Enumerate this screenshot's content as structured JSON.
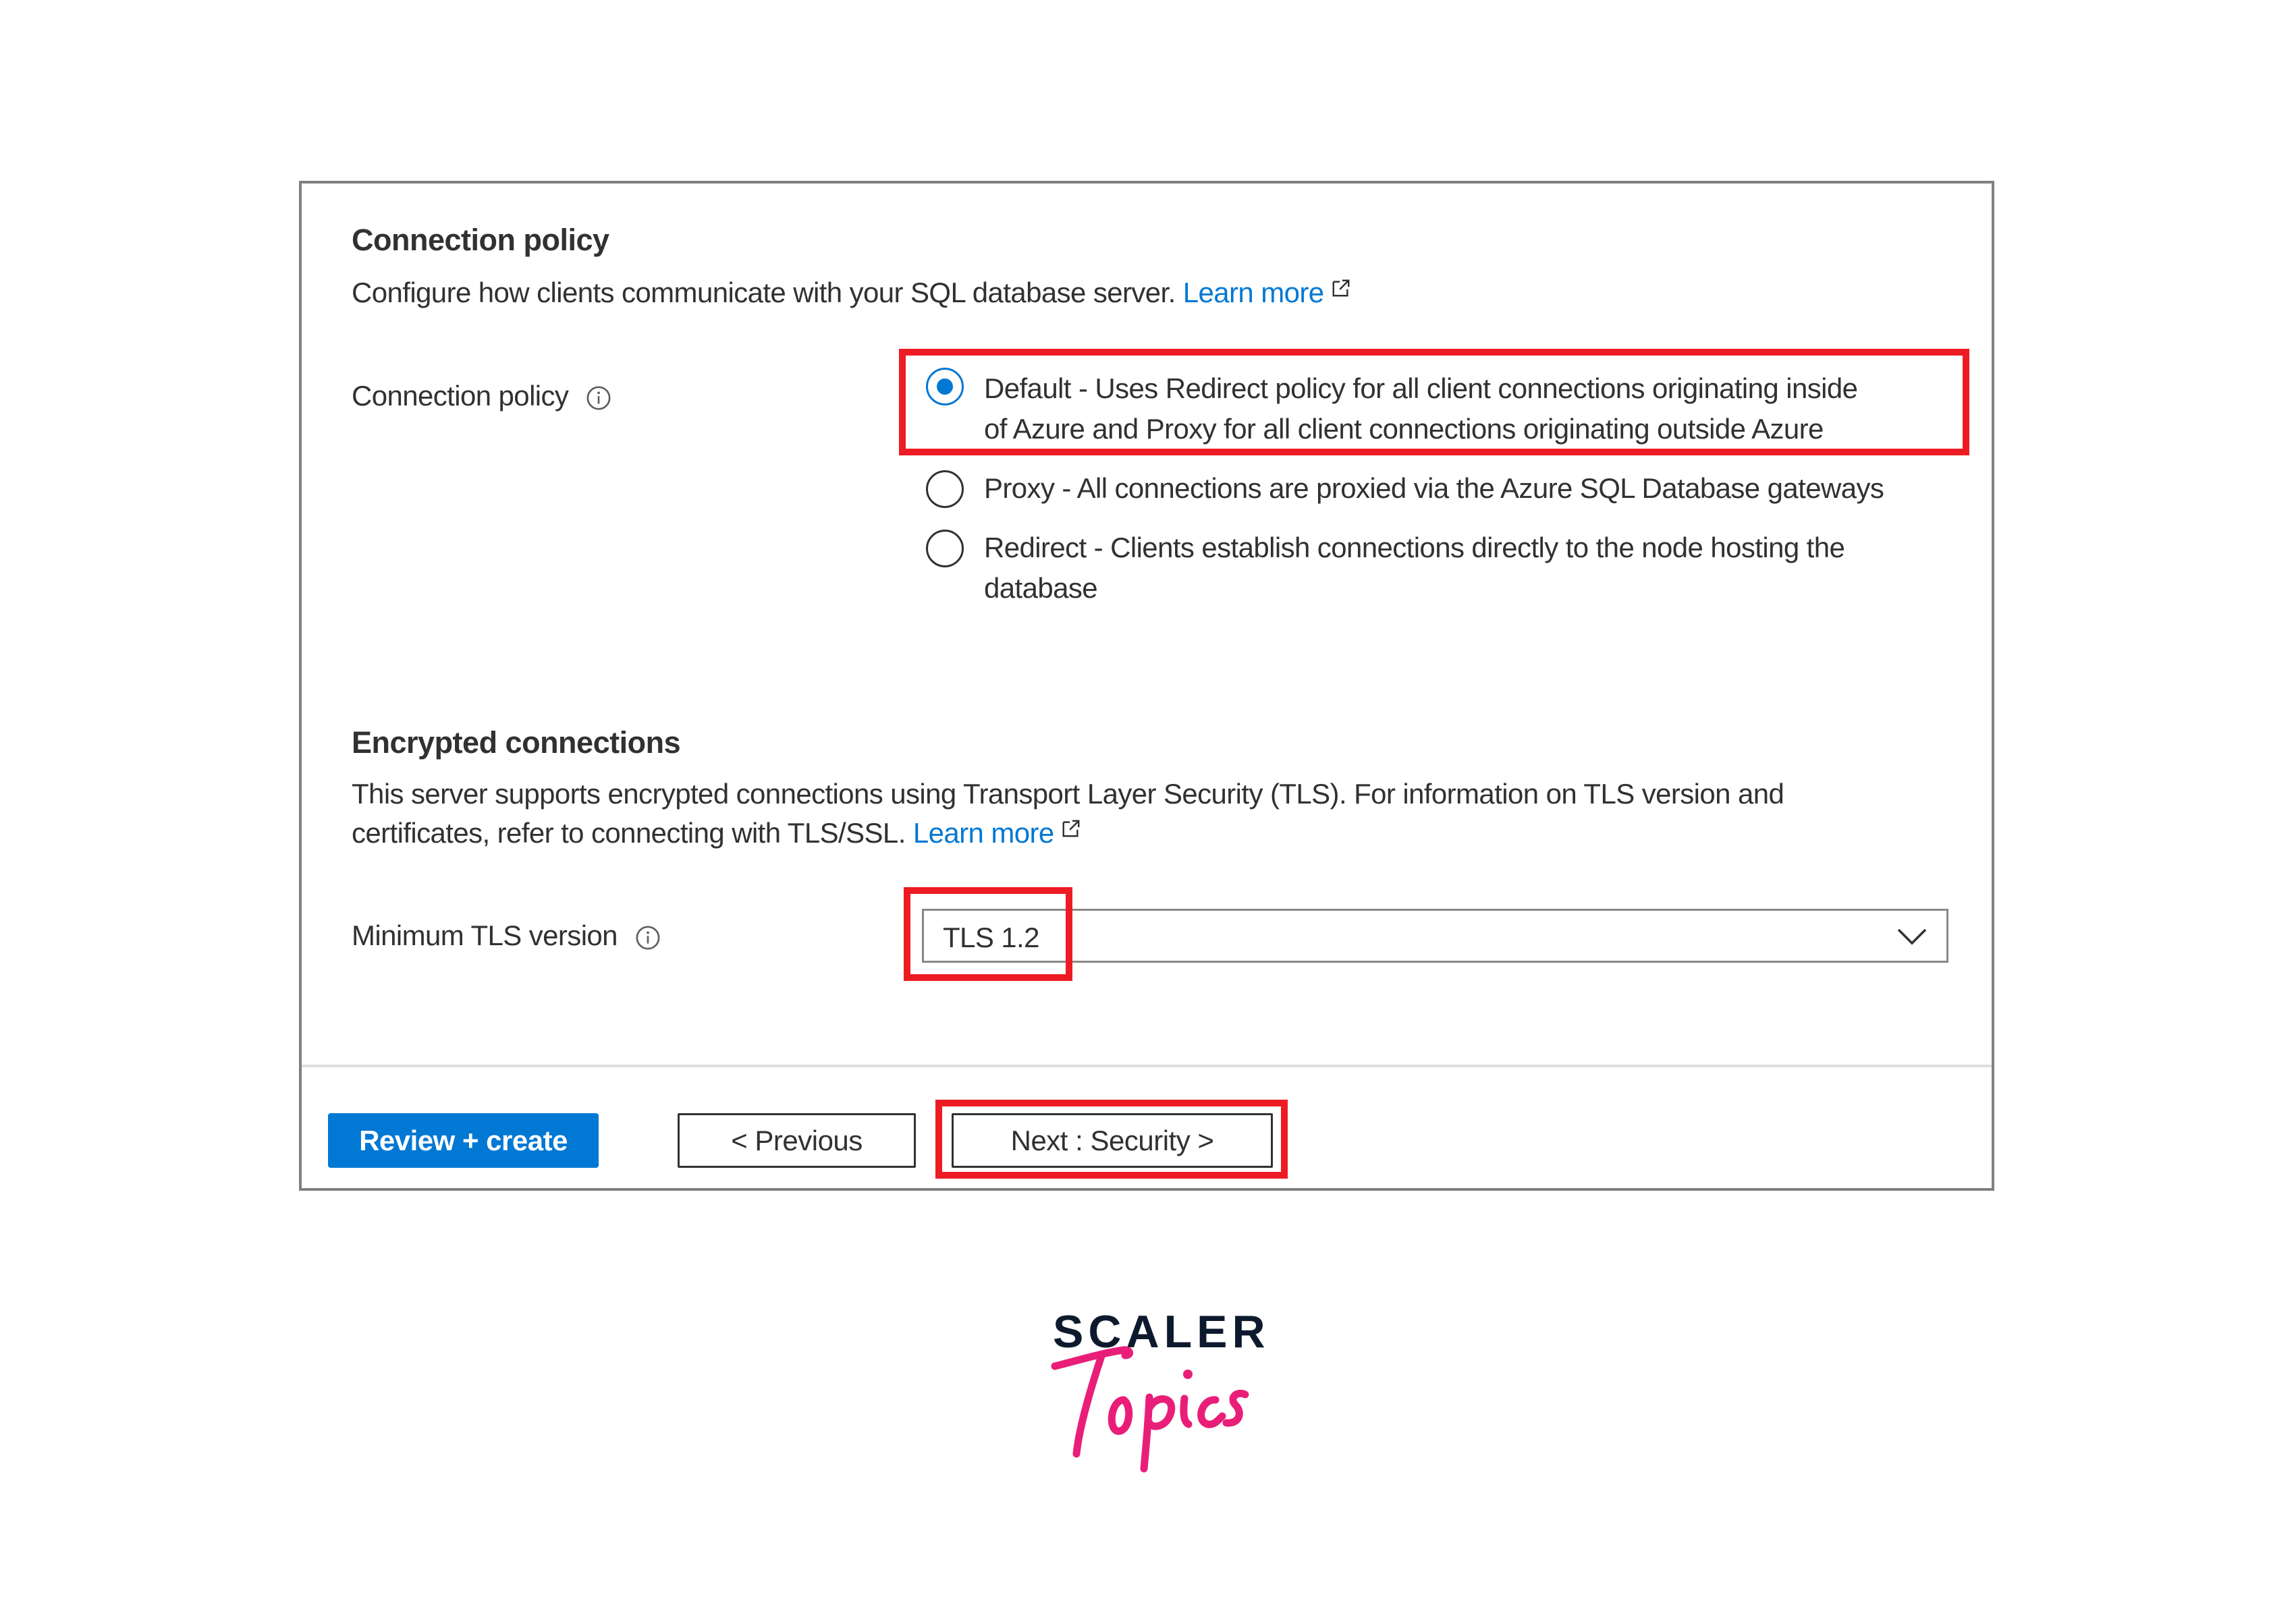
{
  "connection_policy_section": {
    "title": "Connection policy",
    "description": "Configure how clients communicate with your SQL database server.",
    "learn_more": "Learn more",
    "field_label": "Connection policy",
    "options": [
      {
        "label": "Default - Uses Redirect policy for all client connections originating inside",
        "label_line2": "of Azure and Proxy for all client connections originating outside Azure",
        "selected": true
      },
      {
        "label": "Proxy - All connections are proxied via the Azure SQL Database gateways",
        "selected": false
      },
      {
        "label": "Redirect - Clients establish connections directly to the node hosting the",
        "label_line2": "database",
        "selected": false
      }
    ]
  },
  "encrypted_section": {
    "title": "Encrypted connections",
    "description_line1": "This server supports encrypted connections using Transport Layer Security (TLS). For information on TLS version and",
    "description_line2": "certificates, refer to connecting with TLS/SSL.",
    "learn_more": "Learn more",
    "field_label": "Minimum TLS version",
    "tls_selected": "TLS 1.2"
  },
  "footer": {
    "review_create": "Review + create",
    "previous": "< Previous",
    "next": "Next : Security >"
  },
  "branding": {
    "line1": "SCALER",
    "line2": "Topics"
  },
  "colors": {
    "accent": "#0078d4",
    "highlight": "#ed1c24",
    "brand_pink": "#e91e78",
    "brand_dark": "#0d1a2d"
  }
}
